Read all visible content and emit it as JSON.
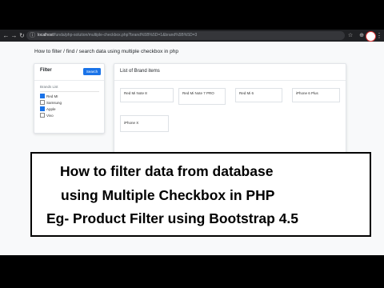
{
  "browser": {
    "url_host": "localhost",
    "url_path": "/funda/php-solution/multiple-checkbox.php?brand%5B%5D=1&brand%5B%5D=3"
  },
  "page": {
    "title": "How to filter / find / search data using multiple checkbox in php"
  },
  "filter": {
    "title": "Filter",
    "search_label": "Search",
    "brands_label": "Brands List",
    "brands": [
      {
        "label": "Red MI",
        "checked": true
      },
      {
        "label": "Samsung",
        "checked": false
      },
      {
        "label": "Apple",
        "checked": true
      },
      {
        "label": "Vivo",
        "checked": false
      }
    ]
  },
  "brand_list": {
    "title": "List of Brand items",
    "items": [
      "Red Mi Note 8",
      "Red Mi Note 7 PRO",
      "Red Mi 6",
      "iPhone 6 Plus",
      "iPhone X"
    ]
  },
  "caption": {
    "line1": "How to filter data from database",
    "line2": "using Multiple Checkbox in PHP",
    "line3": "Eg- Product Filter using Bootstrap 4.5"
  },
  "colors": {
    "primary_button": "#1a73e8",
    "browser_chrome": "#202124"
  }
}
